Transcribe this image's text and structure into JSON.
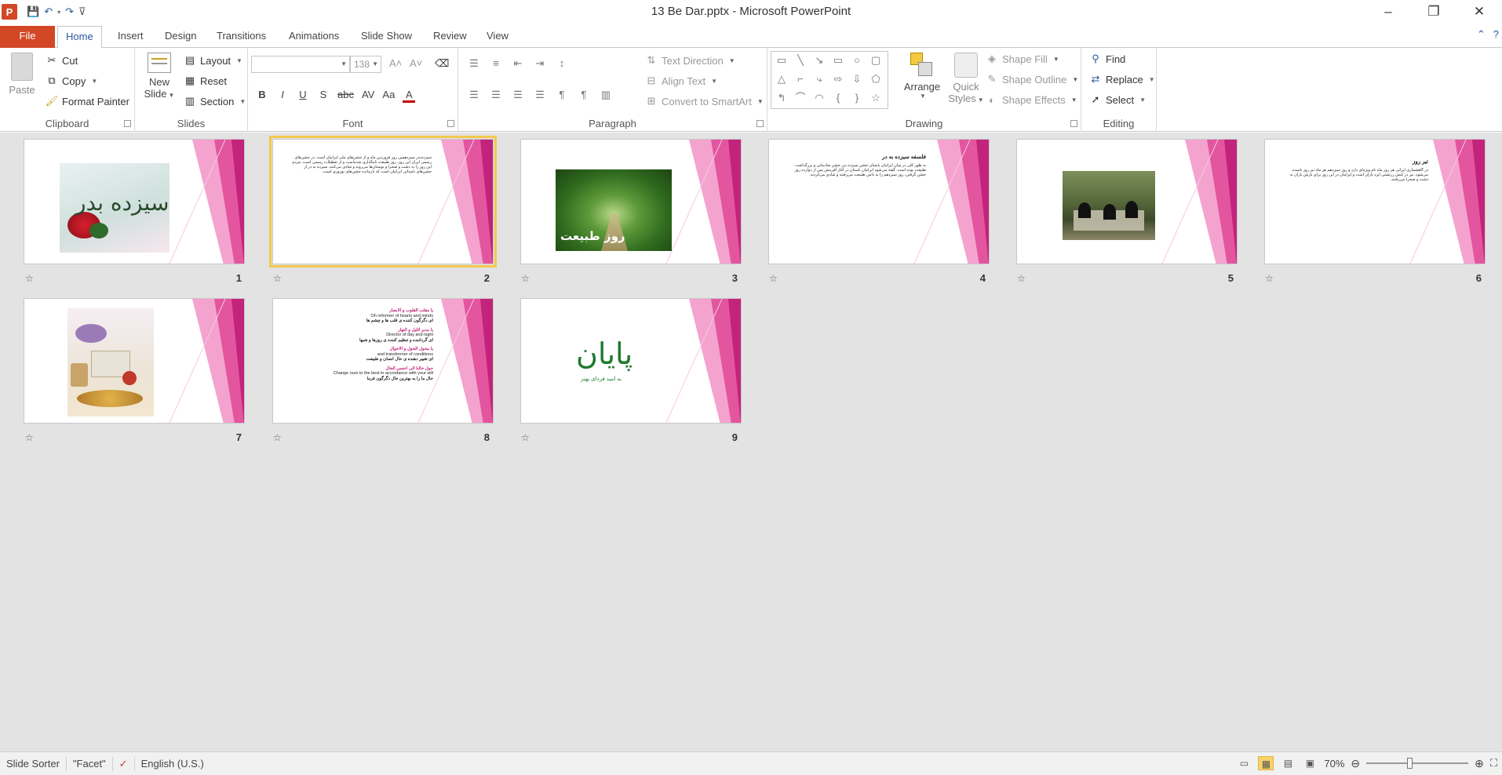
{
  "window": {
    "title": "13 Be Dar.pptx - Microsoft PowerPoint",
    "app_icon_label": "P",
    "controls": [
      "–",
      "❐",
      "✕"
    ]
  },
  "qat": {
    "save_icon": "save-icon",
    "undo_icon": "undo-icon",
    "redo_icon": "redo-icon",
    "customize_icon": "customize-icon"
  },
  "tabs": [
    {
      "label": "File"
    },
    {
      "label": "Home"
    },
    {
      "label": "Insert"
    },
    {
      "label": "Design"
    },
    {
      "label": "Transitions"
    },
    {
      "label": "Animations"
    },
    {
      "label": "Slide Show"
    },
    {
      "label": "Review"
    },
    {
      "label": "View"
    }
  ],
  "ribbon": {
    "clipboard": {
      "label": "Clipboard",
      "paste": "Paste",
      "cut": "Cut",
      "copy": "Copy",
      "format_painter": "Format Painter"
    },
    "slides": {
      "label": "Slides",
      "new_slide_line1": "New",
      "new_slide_line2": "Slide",
      "layout": "Layout",
      "reset": "Reset",
      "section": "Section"
    },
    "font": {
      "label": "Font",
      "font_name": "",
      "font_size": "138",
      "buttons": [
        "B",
        "I",
        "U",
        "S",
        "abc",
        "AV",
        "Aa",
        "A"
      ]
    },
    "paragraph": {
      "label": "Paragraph",
      "text_direction": "Text Direction",
      "align_text": "Align Text",
      "convert_smartart": "Convert to SmartArt"
    },
    "drawing": {
      "label": "Drawing",
      "arrange": "Arrange",
      "quick_styles_line1": "Quick",
      "quick_styles_line2": "Styles",
      "shape_fill": "Shape Fill",
      "shape_outline": "Shape Outline",
      "shape_effects": "Shape Effects"
    },
    "editing": {
      "label": "Editing",
      "find": "Find",
      "replace": "Replace",
      "select": "Select"
    }
  },
  "slides": [
    {
      "number": "1",
      "kind": "image",
      "image_text": "سیزده بدر"
    },
    {
      "number": "2",
      "kind": "text",
      "heading": "",
      "body": "سیزده‌بدر سیزدهمین روز فروردین ماه و از جشن‌های ملی ایرانیان است. در جشن‌های رسمی ایران این روز، روز طبیعت نامگذاری شده‌است و از تعطیلات رسمی است. مردم این روز را به دشت و صحرا و بوستان‌ها می‌روند و شادی می‌کنند. سیزده به در از جشن‌های باستانی ایرانیان است که بازمانده جشن‌های نوروزی است."
    },
    {
      "number": "3",
      "kind": "image",
      "image_text": "روز طبیعت"
    },
    {
      "number": "4",
      "kind": "text",
      "heading": "فلسفه سیزده به در",
      "body": "به طور کلی در میان ایرانیان باستان جشن سیزده بدر جشن شادمانی و بزرگداشت طبیعت بوده است. گفته می‌شود ایرانیان باستان در آغاز آفرینش پس از دوازده روز جشن گرفتن، روز سیزدهم را به دامن طبیعت می‌رفتند و شادی می‌کردند."
    },
    {
      "number": "5",
      "kind": "image",
      "image_text": ""
    },
    {
      "number": "6",
      "kind": "text",
      "heading": "تیر روز",
      "body": "در گاهشماری ایرانی هر روز ماه نام ویژه‌ای دارد و روز سیزدهم هر ماه تیر روز نامیده می‌شود. تیر در کیش زرتشتی ایزد باران است و ایرانیان در این روز برای بارش باران به دشت و صحرا می‌رفتند."
    },
    {
      "number": "7",
      "kind": "image",
      "image_text": ""
    },
    {
      "number": "8",
      "kind": "prayer",
      "lines": [
        "یا مقلب القلوب و الابصار",
        "Oh reformer of hearts and minds",
        "ای دگرگون کننده ی قلب ها و چشم ها",
        "یا مدبر اللیل و النهار",
        "Director of day and night",
        "ای گرداننده و تنظیم کننده ی روزها و شبها",
        "یا محول الحول و الاحوال",
        "and transformer of conditions",
        "ای تغییر دهنده ی حال انسان و طبیعت",
        "حول حالنا الی احسن الحال",
        "Change ours to the best in accordance with your will",
        "حال ما را به بهترین حال دگرگون فرما"
      ]
    },
    {
      "number": "9",
      "kind": "end",
      "end_text": "پایان",
      "caption": "به امید فردای بهتر"
    }
  ],
  "status": {
    "view": "Slide Sorter",
    "theme": "\"Facet\"",
    "language": "English (U.S.)",
    "zoom": "70%"
  }
}
